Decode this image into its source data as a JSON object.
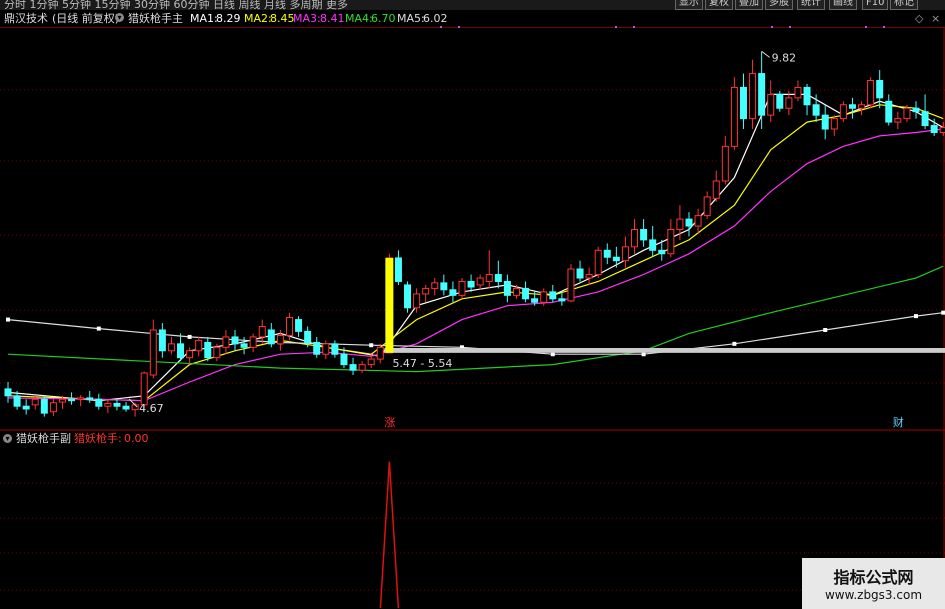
{
  "toolbar": {
    "periods": [
      "分时",
      "1分钟",
      "5分钟",
      "15分钟",
      "30分钟",
      "60分钟",
      "日线",
      "周线",
      "月线",
      "多周期",
      "更多"
    ],
    "active_period": "日线",
    "buttons": [
      "显示",
      "复权",
      "叠加",
      "多股",
      "统计",
      "画线",
      "F10",
      "标记"
    ]
  },
  "main_header": {
    "stock_name": "鼎汉技术",
    "chart_mode": "(日线 前复权)",
    "indicator": "猎妖枪手主",
    "ma": [
      {
        "label": "MA1:",
        "value": "8.29",
        "color": "#ffffff"
      },
      {
        "label": "MA2:",
        "value": "8.45",
        "color": "#ffff00"
      },
      {
        "label": "MA3:",
        "value": "8.41",
        "color": "#ff33ff"
      },
      {
        "label": "MA4:",
        "value": "6.70",
        "color": "#33dd33"
      },
      {
        "label": "MA5:",
        "value": "6.02",
        "color": "#dddddd"
      }
    ]
  },
  "sub_header": {
    "indicator": "猎妖枪手副",
    "series_label": "猎妖枪手:",
    "series_value": "0.00"
  },
  "chart_data": [
    {
      "type": "candlestick",
      "title": "猎妖枪手主",
      "up_color": "#ff3333",
      "down_color": "#44ffff",
      "candles": [
        [
          4.95,
          5.05,
          4.75,
          4.85
        ],
        [
          4.85,
          4.92,
          4.65,
          4.7
        ],
        [
          4.7,
          4.8,
          4.58,
          4.66
        ],
        [
          4.72,
          4.85,
          4.65,
          4.8
        ],
        [
          4.8,
          4.85,
          4.55,
          4.6
        ],
        [
          4.62,
          4.8,
          4.56,
          4.75
        ],
        [
          4.76,
          4.85,
          4.66,
          4.8
        ],
        [
          4.8,
          4.9,
          4.72,
          4.78
        ],
        [
          4.8,
          4.86,
          4.7,
          4.82
        ],
        [
          4.82,
          4.92,
          4.75,
          4.8
        ],
        [
          4.8,
          4.88,
          4.65,
          4.7
        ],
        [
          4.7,
          4.78,
          4.6,
          4.74
        ],
        [
          4.74,
          4.8,
          4.64,
          4.7
        ],
        [
          4.7,
          4.76,
          4.62,
          4.66
        ],
        [
          4.65,
          4.75,
          4.55,
          4.72
        ],
        [
          4.72,
          5.2,
          4.67,
          5.18
        ],
        [
          5.15,
          5.95,
          5.1,
          5.8
        ],
        [
          5.8,
          5.9,
          5.4,
          5.5
        ],
        [
          5.5,
          5.7,
          5.45,
          5.6
        ],
        [
          5.6,
          5.75,
          5.35,
          5.4
        ],
        [
          5.4,
          5.55,
          5.3,
          5.5
        ],
        [
          5.5,
          5.7,
          5.42,
          5.65
        ],
        [
          5.62,
          5.7,
          5.35,
          5.4
        ],
        [
          5.4,
          5.6,
          5.35,
          5.55
        ],
        [
          5.55,
          5.8,
          5.45,
          5.7
        ],
        [
          5.7,
          5.8,
          5.5,
          5.6
        ],
        [
          5.6,
          5.7,
          5.45,
          5.55
        ],
        [
          5.55,
          5.75,
          5.48,
          5.7
        ],
        [
          5.7,
          5.95,
          5.6,
          5.85
        ],
        [
          5.8,
          5.9,
          5.55,
          5.6
        ],
        [
          5.6,
          5.8,
          5.5,
          5.72
        ],
        [
          5.72,
          6.05,
          5.65,
          5.98
        ],
        [
          5.95,
          6.0,
          5.7,
          5.78
        ],
        [
          5.78,
          5.85,
          5.55,
          5.62
        ],
        [
          5.62,
          5.7,
          5.4,
          5.45
        ],
        [
          5.45,
          5.65,
          5.38,
          5.6
        ],
        [
          5.6,
          5.65,
          5.4,
          5.45
        ],
        [
          5.45,
          5.55,
          5.25,
          5.3
        ],
        [
          5.3,
          5.4,
          5.15,
          5.22
        ],
        [
          5.22,
          5.35,
          5.18,
          5.3
        ],
        [
          5.3,
          5.45,
          5.25,
          5.38
        ],
        [
          5.38,
          5.6,
          5.32,
          5.55
        ],
        [
          5.47,
          6.9,
          5.47,
          6.84
        ],
        [
          6.84,
          6.95,
          6.45,
          6.5
        ],
        [
          6.45,
          6.5,
          6.05,
          6.12
        ],
        [
          6.12,
          6.4,
          6.05,
          6.32
        ],
        [
          6.32,
          6.45,
          6.2,
          6.4
        ],
        [
          6.4,
          6.55,
          6.3,
          6.48
        ],
        [
          6.48,
          6.6,
          6.3,
          6.38
        ],
        [
          6.38,
          6.5,
          6.2,
          6.3
        ],
        [
          6.3,
          6.55,
          6.25,
          6.5
        ],
        [
          6.5,
          6.6,
          6.35,
          6.42
        ],
        [
          6.45,
          6.6,
          6.38,
          6.55
        ],
        [
          6.5,
          6.95,
          6.4,
          6.6
        ],
        [
          6.6,
          6.8,
          6.4,
          6.5
        ],
        [
          6.5,
          6.6,
          6.2,
          6.3
        ],
        [
          6.3,
          6.45,
          6.25,
          6.4
        ],
        [
          6.4,
          6.5,
          6.2,
          6.25
        ],
        [
          6.25,
          6.35,
          6.15,
          6.2
        ],
        [
          6.2,
          6.4,
          6.15,
          6.35
        ],
        [
          6.35,
          6.45,
          6.2,
          6.25
        ],
        [
          6.25,
          6.35,
          6.15,
          6.22
        ],
        [
          6.22,
          6.75,
          6.2,
          6.68
        ],
        [
          6.68,
          6.8,
          6.5,
          6.55
        ],
        [
          6.55,
          6.7,
          6.45,
          6.6
        ],
        [
          6.6,
          7.0,
          6.55,
          6.95
        ],
        [
          6.95,
          7.05,
          6.75,
          6.85
        ],
        [
          6.85,
          7.0,
          6.7,
          6.8
        ],
        [
          6.8,
          7.15,
          6.7,
          7.0
        ],
        [
          7.0,
          7.4,
          6.9,
          7.25
        ],
        [
          7.25,
          7.4,
          7.0,
          7.1
        ],
        [
          7.1,
          7.3,
          6.85,
          6.95
        ],
        [
          6.95,
          7.1,
          6.8,
          6.9
        ],
        [
          6.9,
          7.4,
          6.85,
          7.25
        ],
        [
          7.25,
          7.6,
          7.1,
          7.4
        ],
        [
          7.4,
          7.5,
          7.15,
          7.3
        ],
        [
          7.3,
          7.55,
          7.2,
          7.45
        ],
        [
          7.45,
          7.8,
          7.4,
          7.72
        ],
        [
          7.7,
          8.1,
          7.65,
          7.95
        ],
        [
          7.95,
          8.6,
          7.9,
          8.45
        ],
        [
          8.45,
          9.45,
          8.4,
          9.3
        ],
        [
          9.3,
          9.5,
          8.7,
          8.85
        ],
        [
          8.85,
          9.7,
          8.7,
          9.5
        ],
        [
          9.5,
          9.82,
          8.7,
          8.9
        ],
        [
          8.9,
          9.4,
          8.8,
          9.2
        ],
        [
          9.2,
          9.25,
          8.95,
          9.0
        ],
        [
          9.0,
          9.25,
          8.9,
          9.15
        ],
        [
          9.15,
          9.4,
          9.1,
          9.3
        ],
        [
          9.3,
          9.35,
          8.9,
          9.05
        ],
        [
          9.05,
          9.2,
          8.8,
          8.9
        ],
        [
          8.9,
          9.05,
          8.55,
          8.7
        ],
        [
          8.7,
          8.9,
          8.6,
          8.85
        ],
        [
          8.85,
          9.1,
          8.8,
          9.05
        ],
        [
          9.05,
          9.15,
          8.85,
          9.0
        ],
        [
          9.0,
          9.1,
          8.9,
          9.05
        ],
        [
          9.05,
          9.45,
          9.0,
          9.4
        ],
        [
          9.4,
          9.55,
          9.0,
          9.15
        ],
        [
          9.1,
          9.2,
          8.75,
          8.8
        ],
        [
          8.8,
          8.95,
          8.7,
          8.85
        ],
        [
          8.85,
          9.05,
          8.8,
          9.0
        ],
        [
          9.0,
          9.1,
          8.85,
          8.95
        ],
        [
          8.95,
          9.2,
          8.7,
          8.75
        ],
        [
          8.75,
          8.85,
          8.6,
          8.65
        ],
        [
          8.65,
          8.8,
          8.6,
          8.72
        ]
      ],
      "moving_averages": [
        {
          "name": "MA1",
          "color": "#ffffff",
          "points": [
            [
              0,
              4.9
            ],
            [
              10,
              4.78
            ],
            [
              15,
              4.85
            ],
            [
              20,
              5.5
            ],
            [
              25,
              5.6
            ],
            [
              30,
              5.75
            ],
            [
              35,
              5.55
            ],
            [
              41,
              5.42
            ],
            [
              45,
              6.15
            ],
            [
              50,
              6.35
            ],
            [
              55,
              6.45
            ],
            [
              60,
              6.3
            ],
            [
              65,
              6.6
            ],
            [
              70,
              6.95
            ],
            [
              75,
              7.25
            ],
            [
              80,
              8.0
            ],
            [
              84,
              9.2
            ],
            [
              88,
              9.2
            ],
            [
              92,
              8.9
            ],
            [
              96,
              9.1
            ],
            [
              100,
              8.95
            ],
            [
              103,
              8.72
            ]
          ]
        },
        {
          "name": "MA2",
          "color": "#ffff00",
          "points": [
            [
              0,
              4.85
            ],
            [
              10,
              4.8
            ],
            [
              15,
              4.78
            ],
            [
              20,
              5.3
            ],
            [
              25,
              5.5
            ],
            [
              30,
              5.65
            ],
            [
              35,
              5.55
            ],
            [
              40,
              5.45
            ],
            [
              45,
              5.95
            ],
            [
              50,
              6.25
            ],
            [
              55,
              6.35
            ],
            [
              60,
              6.3
            ],
            [
              65,
              6.5
            ],
            [
              70,
              6.8
            ],
            [
              75,
              7.1
            ],
            [
              80,
              7.6
            ],
            [
              84,
              8.4
            ],
            [
              88,
              8.8
            ],
            [
              92,
              8.9
            ],
            [
              96,
              9.05
            ],
            [
              100,
              9.0
            ],
            [
              103,
              8.85
            ]
          ]
        },
        {
          "name": "MA3",
          "color": "#ff33ff",
          "points": [
            [
              0,
              4.82
            ],
            [
              10,
              4.8
            ],
            [
              15,
              4.78
            ],
            [
              20,
              5.05
            ],
            [
              25,
              5.3
            ],
            [
              30,
              5.45
            ],
            [
              35,
              5.48
            ],
            [
              40,
              5.42
            ],
            [
              45,
              5.6
            ],
            [
              50,
              5.95
            ],
            [
              55,
              6.15
            ],
            [
              60,
              6.2
            ],
            [
              65,
              6.35
            ],
            [
              70,
              6.6
            ],
            [
              75,
              6.9
            ],
            [
              80,
              7.3
            ],
            [
              84,
              7.8
            ],
            [
              88,
              8.2
            ],
            [
              92,
              8.45
            ],
            [
              96,
              8.6
            ],
            [
              100,
              8.65
            ],
            [
              103,
              8.7
            ]
          ]
        },
        {
          "name": "MA4",
          "color": "#22cc22",
          "points": [
            [
              0,
              5.45
            ],
            [
              15,
              5.35
            ],
            [
              30,
              5.25
            ],
            [
              45,
              5.2
            ],
            [
              60,
              5.3
            ],
            [
              70,
              5.5
            ],
            [
              75,
              5.75
            ],
            [
              84,
              6.05
            ],
            [
              92,
              6.3
            ],
            [
              100,
              6.55
            ],
            [
              103,
              6.72
            ]
          ]
        },
        {
          "name": "MA5",
          "color": "#dddddd",
          "points": [
            [
              0,
              5.95
            ],
            [
              10,
              5.82
            ],
            [
              20,
              5.7
            ],
            [
              30,
              5.62
            ],
            [
              40,
              5.58
            ],
            [
              50,
              5.55
            ],
            [
              60,
              5.45
            ],
            [
              70,
              5.45
            ],
            [
              80,
              5.6
            ],
            [
              90,
              5.8
            ],
            [
              100,
              6.0
            ],
            [
              103,
              6.05
            ]
          ]
        }
      ],
      "signal_bar": {
        "index": 42,
        "bottom": 5.47,
        "top": 6.84,
        "color": "#ffff00"
      },
      "support_band": {
        "low": 5.47,
        "high": 5.54,
        "color": "#cccccc"
      },
      "annotations": [
        {
          "text": "9.82",
          "index": 83,
          "value": 9.82
        },
        {
          "text": "4.67",
          "index": 14,
          "value": 4.55
        },
        {
          "text": "5.47 - 5.54",
          "index": 43,
          "value": 5.47
        }
      ],
      "markers": [
        {
          "text": "涨",
          "index": 42,
          "color": "#ff3333"
        },
        {
          "text": "财",
          "index": 98,
          "color": "#66ccff"
        }
      ],
      "ylim": [
        4.4,
        10.1
      ]
    },
    {
      "type": "line",
      "title": "猎妖枪手副",
      "series": [
        {
          "name": "猎妖枪手",
          "color": "#dd1111",
          "spikes": [
            {
              "index": 42,
              "value": 1
            }
          ]
        }
      ],
      "ylim": [
        0,
        1.08
      ]
    }
  ]
}
